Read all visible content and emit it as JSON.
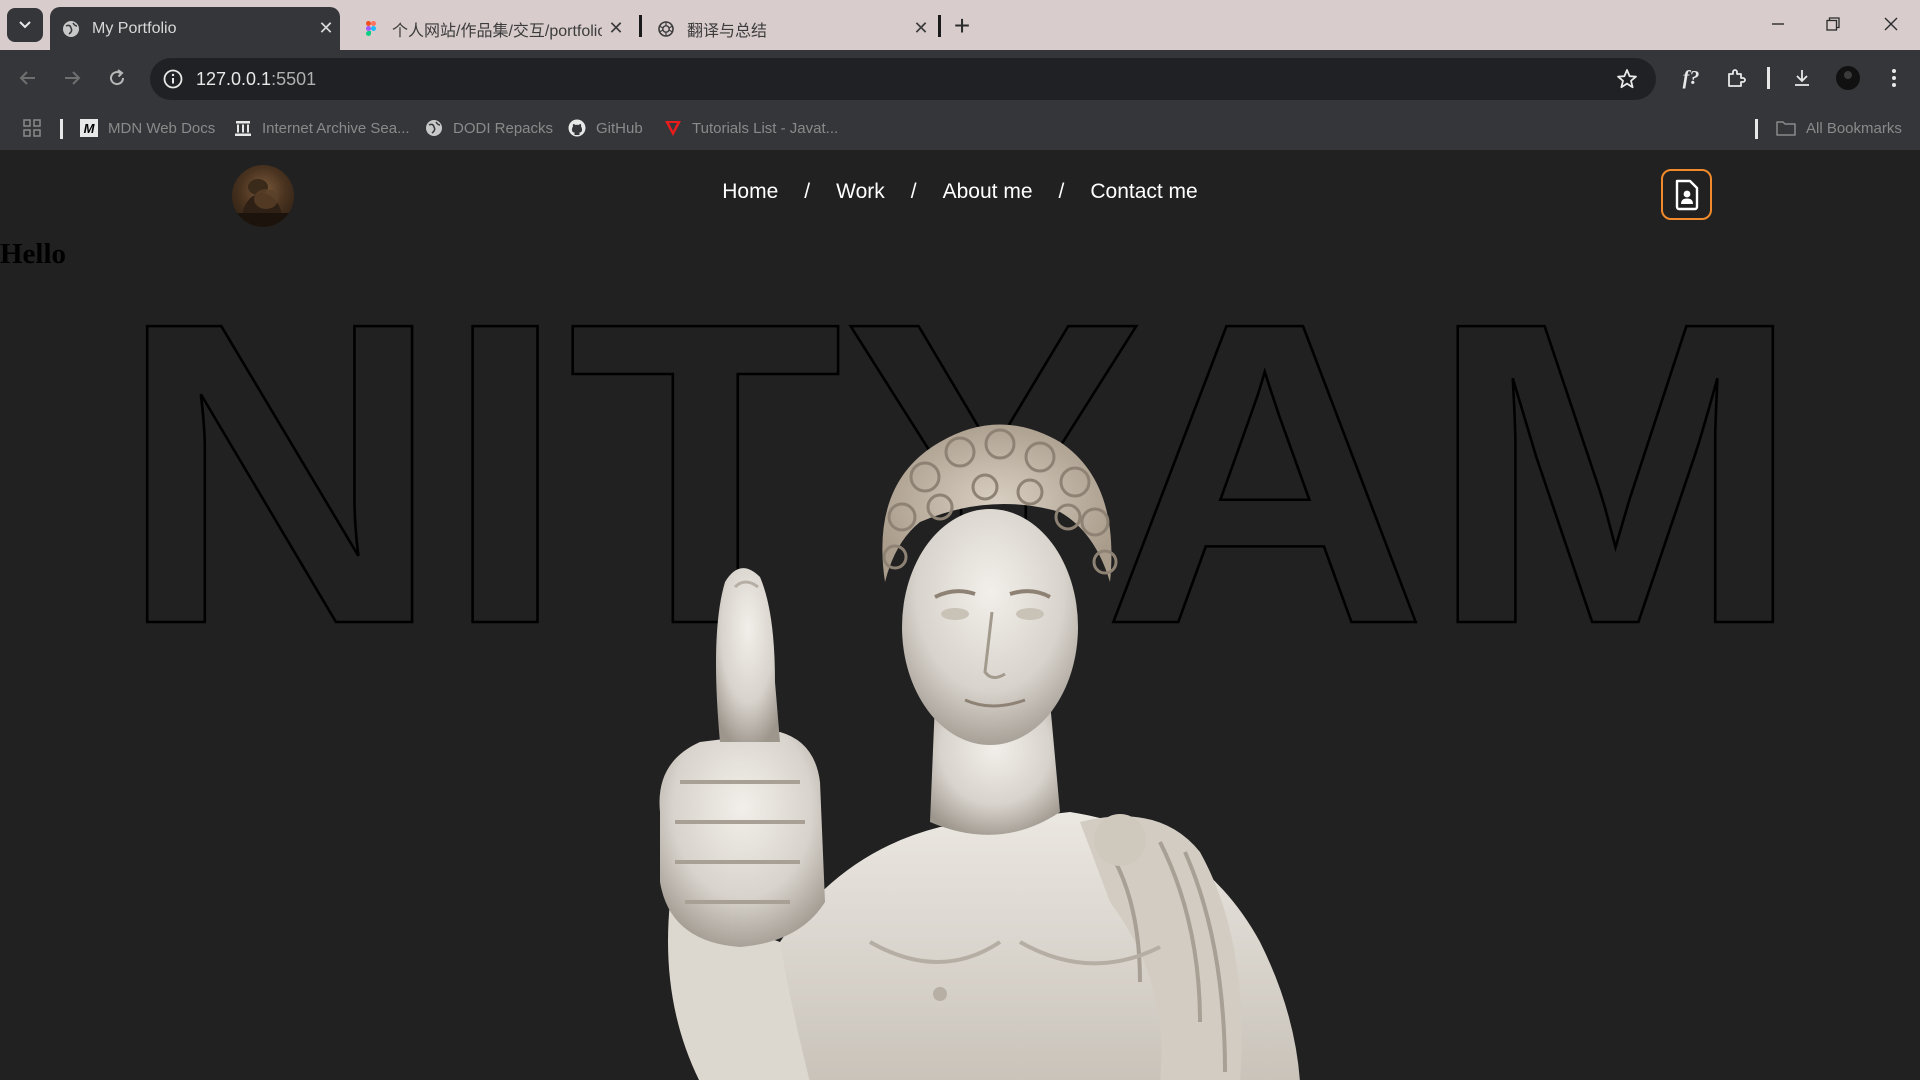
{
  "browser": {
    "tabs": [
      {
        "title": "My Portfolio",
        "active": true
      },
      {
        "title": "个人网站/作品集/交互/portfolio",
        "active": false
      },
      {
        "title": "翻译与总结",
        "active": false
      }
    ],
    "url_host": "127.0.0.1",
    "url_port": ":5501",
    "bookmarks": [
      {
        "label": "MDN Web Docs",
        "icon": "mdn-icon"
      },
      {
        "label": "Internet Archive Sea...",
        "icon": "archive-icon"
      },
      {
        "label": "DODI Repacks",
        "icon": "globe-icon"
      },
      {
        "label": "GitHub",
        "icon": "github-icon"
      },
      {
        "label": "Tutorials List - Javat...",
        "icon": "javatpoint-icon"
      }
    ],
    "all_bookmarks_label": "All Bookmarks"
  },
  "page": {
    "nav": {
      "home": "Home",
      "work": "Work",
      "about": "About me",
      "contact": "Contact me",
      "separator": "/"
    },
    "hello": "Hello",
    "hero_name": "NITYAM",
    "colors": {
      "background": "#212121",
      "accent": "#f08a2a",
      "outline": "#000000"
    }
  }
}
